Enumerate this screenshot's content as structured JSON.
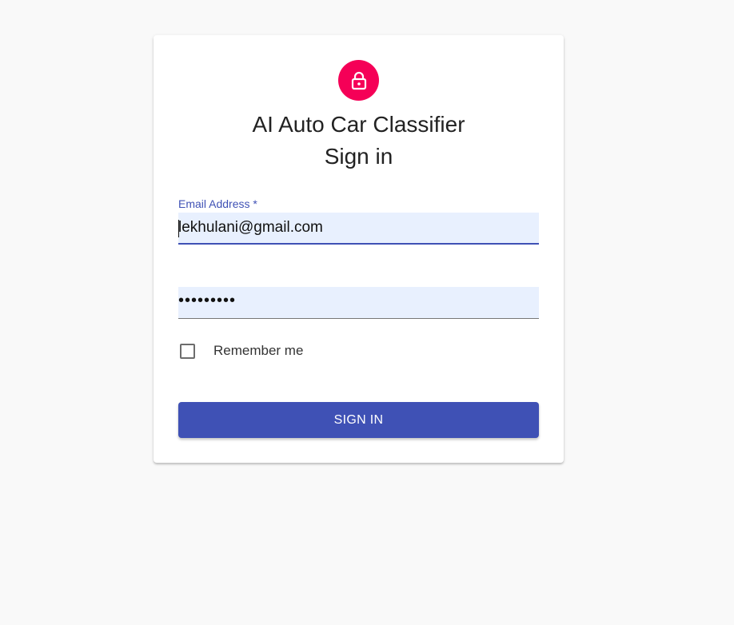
{
  "header": {
    "app_title": "AI Auto Car Classifier",
    "subtitle": "Sign in"
  },
  "form": {
    "email_label": "Email Address *",
    "email_value": "lekhulani@gmail.com",
    "password_value": "•••••••••",
    "remember_label": "Remember me",
    "remember_checked": false,
    "submit_label": "SIGN IN"
  },
  "icons": {
    "avatar": "lock-icon"
  },
  "colors": {
    "accent": "#3f51b5",
    "avatar_bg": "#f50057",
    "input_bg": "#e8f0fe",
    "page_bg": "#f9f9f9"
  }
}
